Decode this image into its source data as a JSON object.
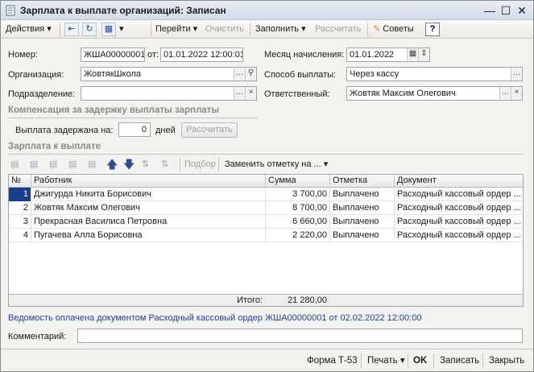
{
  "window": {
    "title": "Зарплата к выплате организаций: Записан"
  },
  "toolbar": {
    "actions": "Действия",
    "goto": "Перейти",
    "clear": "Очистить",
    "fill": "Заполнить",
    "calculate": "Рассчитать",
    "tips": "Советы",
    "help": "?"
  },
  "header": {
    "number_label": "Номер:",
    "number_value": "ЖША00000001",
    "from_label": "от:",
    "date_value": "01.01.2022 12:00:01",
    "month_label": "Месяц начисления:",
    "month_value": "01.01.2022",
    "org_label": "Организация:",
    "org_value": "ЖовтякШкола",
    "payment_label": "Способ выплаты:",
    "payment_value": "Через кассу",
    "division_label": "Подразделение:",
    "division_value": "",
    "responsible_label": "Ответственный:",
    "responsible_value": "Жовтяк Максим Олегович"
  },
  "compensation": {
    "title": "Компенсация за задержку выплаты зарплаты",
    "delay_label": "Выплата задержана на:",
    "delay_value": "0",
    "days_label": "дней",
    "calc_button": "Рассчитать"
  },
  "salary": {
    "title": "Зарплата к выплате",
    "pick_button": "Подбор",
    "replace_mark": "Заменить отметку на ...",
    "columns": [
      "№",
      "Работник",
      "Сумма",
      "Отметка",
      "Документ"
    ],
    "rows": [
      {
        "n": "1",
        "employee": "Джигурда Никита Борисович",
        "sum": "3 700,00",
        "mark": "Выплачено",
        "doc": "Расходный кассовый ордер ..."
      },
      {
        "n": "2",
        "employee": "Жовтяк Максим Олегович",
        "sum": "8 700,00",
        "mark": "Выплачено",
        "doc": "Расходный кассовый ордер ..."
      },
      {
        "n": "3",
        "employee": "Прекрасная Василиса Петровна",
        "sum": "6 660,00",
        "mark": "Выплачено",
        "doc": "Расходный кассовый ордер ..."
      },
      {
        "n": "4",
        "employee": "Пугачева Алла Борисовна",
        "sum": "2 220,00",
        "mark": "Выплачено",
        "doc": "Расходный кассовый ордер ..."
      }
    ],
    "total_label": "Итого:",
    "total_value": "21 280,00"
  },
  "statement_link": "Ведомость оплачена документом Расходный кассовый ордер ЖША00000001 от 02.02.2022 12:00:00",
  "comment": {
    "label": "Комментарий:",
    "value": ""
  },
  "bottom": {
    "form": "Форма Т-53",
    "print": "Печать",
    "ok": "OK",
    "save": "Записать",
    "close": "Закрыть"
  },
  "colors": {
    "accent": "#1f3f9a",
    "selected_row": "#1a3c8c"
  }
}
